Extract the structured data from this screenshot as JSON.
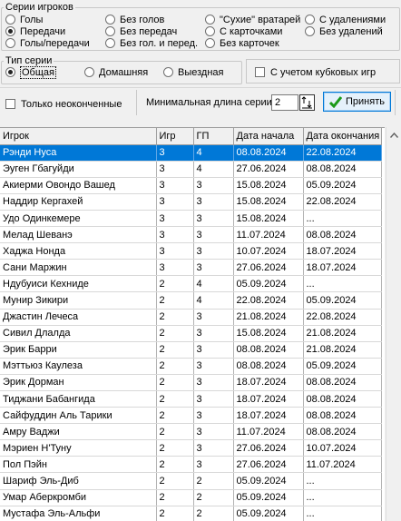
{
  "series_group": {
    "legend": "Серии игроков",
    "options": [
      {
        "label": "Голы",
        "checked": false
      },
      {
        "label": "Передачи",
        "checked": true
      },
      {
        "label": "Голы/передачи",
        "checked": false
      },
      {
        "label": "Без голов",
        "checked": false
      },
      {
        "label": "Без передач",
        "checked": false
      },
      {
        "label": "Без гол. и перед.",
        "checked": false
      },
      {
        "label": "\"Сухие\" вратарей",
        "checked": false
      },
      {
        "label": "С карточками",
        "checked": false
      },
      {
        "label": "Без карточек",
        "checked": false
      },
      {
        "label": "С удалениями",
        "checked": false
      },
      {
        "label": "Без удалений",
        "checked": false
      }
    ]
  },
  "type_group": {
    "legend": "Тип серии",
    "options": [
      {
        "label": "Общая",
        "checked": true
      },
      {
        "label": "Домашняя",
        "checked": false
      },
      {
        "label": "Выездная",
        "checked": false
      }
    ]
  },
  "cup_games_label": "С учетом кубковых игр",
  "unfinished_label": "Только неоконченные",
  "min_length_label": "Минимальная длина серии",
  "min_length_value": "2",
  "accept_label": "Принять",
  "table": {
    "columns": [
      "Игрок",
      "Игр",
      "ГП",
      "Дата начала",
      "Дата окончания"
    ],
    "rows": [
      [
        "Рэнди Нуса",
        "3",
        "4",
        "08.08.2024",
        "22.08.2024"
      ],
      [
        "Эуген Гбагуйди",
        "3",
        "4",
        "27.06.2024",
        "08.08.2024"
      ],
      [
        "Акиерми Овондо Вашед",
        "3",
        "3",
        "15.08.2024",
        "05.09.2024"
      ],
      [
        "Наддир Кергахей",
        "3",
        "3",
        "15.08.2024",
        "22.08.2024"
      ],
      [
        "Удо Одинкемере",
        "3",
        "3",
        "15.08.2024",
        "..."
      ],
      [
        "Мелад Шеванэ",
        "3",
        "3",
        "11.07.2024",
        "08.08.2024"
      ],
      [
        "Хаджа Нонда",
        "3",
        "3",
        "10.07.2024",
        "18.07.2024"
      ],
      [
        "Сани Маржин",
        "3",
        "3",
        "27.06.2024",
        "18.07.2024"
      ],
      [
        "Ндубуиси Кехнидe",
        "2",
        "4",
        "05.09.2024",
        "..."
      ],
      [
        "Мунир Зикири",
        "2",
        "4",
        "22.08.2024",
        "05.09.2024"
      ],
      [
        "Джастин Лечеса",
        "2",
        "3",
        "21.08.2024",
        "22.08.2024"
      ],
      [
        "Сивил Длалда",
        "2",
        "3",
        "15.08.2024",
        "21.08.2024"
      ],
      [
        "Эрик Барри",
        "2",
        "3",
        "08.08.2024",
        "21.08.2024"
      ],
      [
        "Мэттьюз Каулеза",
        "2",
        "3",
        "08.08.2024",
        "05.09.2024"
      ],
      [
        "Эрик Дорман",
        "2",
        "3",
        "18.07.2024",
        "08.08.2024"
      ],
      [
        "Тиджани Бабангида",
        "2",
        "3",
        "18.07.2024",
        "08.08.2024"
      ],
      [
        "Сайфуддин Аль Тарики",
        "2",
        "3",
        "18.07.2024",
        "08.08.2024"
      ],
      [
        "Амру Ваджи",
        "2",
        "3",
        "11.07.2024",
        "08.08.2024"
      ],
      [
        "Мэриен Н'Туну",
        "2",
        "3",
        "27.06.2024",
        "10.07.2024"
      ],
      [
        "Пол Пэйн",
        "2",
        "3",
        "27.06.2024",
        "11.07.2024"
      ],
      [
        "Шариф Эль-Диб",
        "2",
        "2",
        "05.09.2024",
        "..."
      ],
      [
        "Умар Аберкромби",
        "2",
        "2",
        "05.09.2024",
        "..."
      ],
      [
        "Мустафа Эль-Альфи",
        "2",
        "2",
        "05.09.2024",
        "..."
      ]
    ]
  },
  "colors": {
    "selection": "#0078d7",
    "accent_check": "#1a9a1a"
  }
}
